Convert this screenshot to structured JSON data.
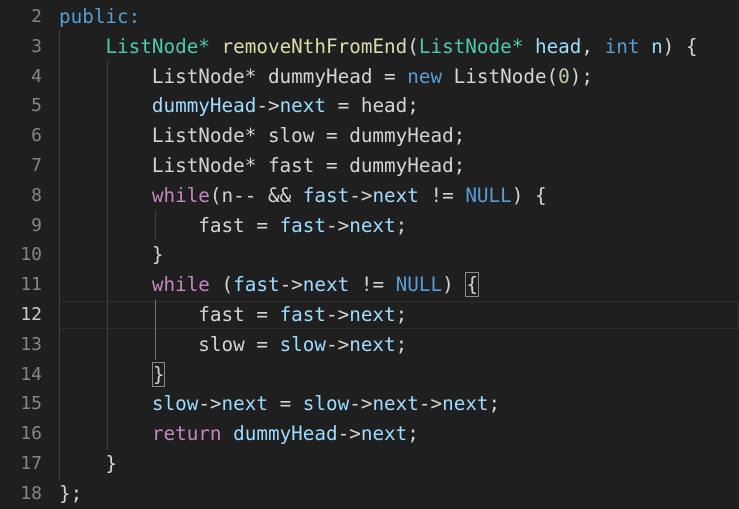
{
  "editor": {
    "lines": [
      {
        "num": "2",
        "tokens": [
          {
            "t": "public:",
            "c": "kw"
          }
        ]
      },
      {
        "num": "3",
        "tokens": [
          {
            "t": "    "
          },
          {
            "t": "ListNode*",
            "c": "type"
          },
          {
            "t": " "
          },
          {
            "t": "removeNthFromEnd",
            "c": "fn"
          },
          {
            "t": "("
          },
          {
            "t": "ListNode*",
            "c": "type"
          },
          {
            "t": " "
          },
          {
            "t": "head",
            "c": "var"
          },
          {
            "t": ", "
          },
          {
            "t": "int",
            "c": "kw"
          },
          {
            "t": " "
          },
          {
            "t": "n",
            "c": "var"
          },
          {
            "t": ") {"
          }
        ]
      },
      {
        "num": "4",
        "tokens": [
          {
            "t": "        ListNode* dummyHead = "
          },
          {
            "t": "new",
            "c": "kw"
          },
          {
            "t": " ListNode("
          },
          {
            "t": "0",
            "c": "num"
          },
          {
            "t": ");"
          }
        ]
      },
      {
        "num": "5",
        "tokens": [
          {
            "t": "        "
          },
          {
            "t": "dummyHead",
            "c": "var"
          },
          {
            "t": "->"
          },
          {
            "t": "next",
            "c": "var"
          },
          {
            "t": " = head;"
          }
        ]
      },
      {
        "num": "6",
        "tokens": [
          {
            "t": "        ListNode* slow = dummyHead;"
          }
        ]
      },
      {
        "num": "7",
        "tokens": [
          {
            "t": "        ListNode* fast = dummyHead;"
          }
        ]
      },
      {
        "num": "8",
        "tokens": [
          {
            "t": "        "
          },
          {
            "t": "while",
            "c": "ctl"
          },
          {
            "t": "(n-- && "
          },
          {
            "t": "fast",
            "c": "var"
          },
          {
            "t": "->"
          },
          {
            "t": "next",
            "c": "var"
          },
          {
            "t": " != "
          },
          {
            "t": "NULL",
            "c": "kw"
          },
          {
            "t": ") {"
          }
        ]
      },
      {
        "num": "9",
        "tokens": [
          {
            "t": "            fast = "
          },
          {
            "t": "fast",
            "c": "var"
          },
          {
            "t": "->"
          },
          {
            "t": "next",
            "c": "var"
          },
          {
            "t": ";"
          }
        ]
      },
      {
        "num": "10",
        "tokens": [
          {
            "t": "        }"
          }
        ]
      },
      {
        "num": "11",
        "tokens": [
          {
            "t": "        "
          },
          {
            "t": "while",
            "c": "ctl"
          },
          {
            "t": " ("
          },
          {
            "t": "fast",
            "c": "var"
          },
          {
            "t": "->"
          },
          {
            "t": "next",
            "c": "var"
          },
          {
            "t": " != "
          },
          {
            "t": "NULL",
            "c": "kw"
          },
          {
            "t": ") "
          },
          {
            "t": "{",
            "c": "bracket-box"
          }
        ]
      },
      {
        "num": "12",
        "active": true,
        "tokens": [
          {
            "t": "            fast = "
          },
          {
            "t": "fast",
            "c": "var"
          },
          {
            "t": "->"
          },
          {
            "t": "next",
            "c": "var"
          },
          {
            "t": ";"
          }
        ]
      },
      {
        "num": "13",
        "tokens": [
          {
            "t": "            slow = "
          },
          {
            "t": "slow",
            "c": "var"
          },
          {
            "t": "->"
          },
          {
            "t": "next",
            "c": "var"
          },
          {
            "t": ";"
          }
        ]
      },
      {
        "num": "14",
        "tokens": [
          {
            "t": "        "
          },
          {
            "t": "}",
            "c": "bracket-box"
          }
        ]
      },
      {
        "num": "15",
        "tokens": [
          {
            "t": "        "
          },
          {
            "t": "slow",
            "c": "var"
          },
          {
            "t": "->"
          },
          {
            "t": "next",
            "c": "var"
          },
          {
            "t": " = "
          },
          {
            "t": "slow",
            "c": "var"
          },
          {
            "t": "->"
          },
          {
            "t": "next",
            "c": "var"
          },
          {
            "t": "->"
          },
          {
            "t": "next",
            "c": "var"
          },
          {
            "t": ";"
          }
        ]
      },
      {
        "num": "16",
        "tokens": [
          {
            "t": "        "
          },
          {
            "t": "return",
            "c": "ctl"
          },
          {
            "t": " "
          },
          {
            "t": "dummyHead",
            "c": "var"
          },
          {
            "t": "->"
          },
          {
            "t": "next",
            "c": "var"
          },
          {
            "t": ";"
          }
        ]
      },
      {
        "num": "17",
        "tokens": [
          {
            "t": "    }"
          }
        ]
      },
      {
        "num": "18",
        "tokens": [
          {
            "t": "};"
          }
        ]
      }
    ]
  },
  "colors": {
    "background": "#1f1f1f",
    "keyword": "#569cd6",
    "control": "#c586c0",
    "type": "#4ec9b0",
    "function": "#dcdcaa",
    "variable": "#9cdcfe",
    "number": "#b5cea8",
    "line_number": "#858585",
    "line_number_active": "#cccccc"
  }
}
